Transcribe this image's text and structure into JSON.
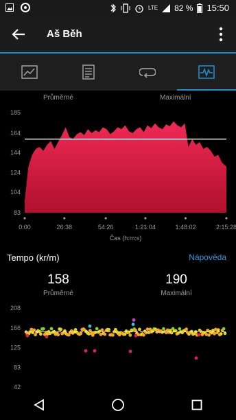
{
  "status_bar": {
    "network": "LTE",
    "battery": "82 %",
    "time": "15:50"
  },
  "app_bar": {
    "title": "Aš Běh"
  },
  "tabs": [
    {
      "icon": "overview-icon",
      "active": false
    },
    {
      "icon": "details-icon",
      "active": false
    },
    {
      "icon": "laps-icon",
      "active": false
    },
    {
      "icon": "charts-icon",
      "active": true
    }
  ],
  "colors": {
    "accent": "#1b8fd0",
    "heart_rate_fill": "#e0234e",
    "link": "#2a9de0"
  },
  "hr_section": {
    "avg_label": "Průměrné",
    "max_label": "Maximální"
  },
  "chart_data": [
    {
      "type": "area",
      "title": "",
      "xlabel": "Čas (h:m:s)",
      "ylabel": "",
      "y_ticks": [
        "185",
        "164",
        "144",
        "124",
        "104",
        "83"
      ],
      "ylim": [
        83,
        185
      ],
      "x_ticks": [
        "0:00",
        "26:38",
        "54:26",
        "1:21:04",
        "1:48:02",
        "2:15:28"
      ],
      "x_seconds": [
        0,
        1598,
        3266,
        4864,
        6482,
        8128
      ],
      "reference_line": 158,
      "series": [
        {
          "x": [
            0,
            150,
            300,
            450,
            600,
            750,
            900,
            1050,
            1200,
            1350,
            1500,
            1650,
            1800,
            1950,
            2100,
            2250,
            2400,
            2550,
            2700,
            2850,
            3000,
            3150,
            3300,
            3450,
            3600,
            3750,
            3900,
            4050,
            4200,
            4350,
            4500,
            4650,
            4800,
            4950,
            5100,
            5250,
            5400,
            5550,
            5700,
            5850,
            6000,
            6150,
            6300,
            6450,
            6600,
            6750,
            6900,
            7050,
            7200,
            7350,
            7500,
            7650,
            7800,
            7950,
            8128
          ],
          "values": [
            95,
            130,
            142,
            148,
            150,
            146,
            152,
            156,
            148,
            155,
            162,
            170,
            160,
            158,
            163,
            165,
            162,
            168,
            164,
            167,
            165,
            170,
            168,
            163,
            166,
            170,
            168,
            172,
            166,
            164,
            168,
            170,
            165,
            172,
            169,
            174,
            170,
            168,
            173,
            171,
            176,
            172,
            170,
            174,
            150,
            158,
            152,
            155,
            148,
            150,
            146,
            140,
            142,
            134,
            130
          ]
        }
      ]
    },
    {
      "type": "scatter",
      "title": "Tempo (kr/m)",
      "y_ticks": [
        "208",
        "166",
        "125",
        "83",
        "42"
      ],
      "ylim": [
        42,
        208
      ],
      "reference_line": 158,
      "avg_value": "158",
      "avg_label": "Průměrné",
      "max_value": "190",
      "max_label": "Maximální"
    }
  ],
  "tempo_section": {
    "title": "Tempo (kr/m)",
    "help_link": "Nápověda"
  },
  "nav_bar": {
    "buttons": [
      "back-icon",
      "home-icon",
      "recents-icon"
    ]
  }
}
